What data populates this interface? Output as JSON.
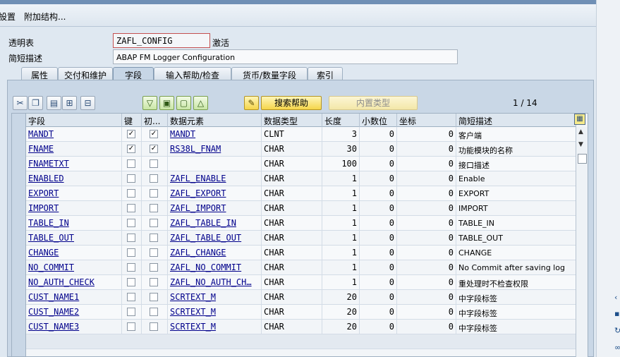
{
  "menu": {
    "item1": "設置",
    "item2": "附加结构..."
  },
  "header": {
    "table_label": "透明表",
    "table_name": "ZAFL_CONFIG",
    "status": "激活",
    "desc_label": "简短描述",
    "desc_value": "ABAP FM Logger Configuration"
  },
  "tabs": [
    "属性",
    "交付和维护",
    "字段",
    "输入帮助/检查",
    "货币/数量字段",
    "索引"
  ],
  "toolbar": {
    "search_help": "搜索帮助",
    "builtin_type": "内置类型",
    "pager": "1  /  14"
  },
  "columns": [
    "字段",
    "键",
    "初...",
    "数据元素",
    "数据类型",
    "长度",
    "小数位",
    "坐标",
    "简短描述"
  ],
  "rows": [
    {
      "field": "MANDT",
      "key": true,
      "init": true,
      "element": "MANDT",
      "type": "CLNT",
      "length": "3",
      "decimals": "0",
      "coord": "0",
      "desc": "客户端"
    },
    {
      "field": "FNAME",
      "key": true,
      "init": true,
      "element": "RS38L_FNAM",
      "type": "CHAR",
      "length": "30",
      "decimals": "0",
      "coord": "0",
      "desc": "功能模块的名称"
    },
    {
      "field": "FNAMETXT",
      "key": false,
      "init": false,
      "element": "",
      "type": "CHAR",
      "length": "100",
      "decimals": "0",
      "coord": "0",
      "desc": "接口描述"
    },
    {
      "field": "ENABLED",
      "key": false,
      "init": false,
      "element": "ZAFL_ENABLE",
      "type": "CHAR",
      "length": "1",
      "decimals": "0",
      "coord": "0",
      "desc": "Enable"
    },
    {
      "field": "EXPORT",
      "key": false,
      "init": false,
      "element": "ZAFL_EXPORT",
      "type": "CHAR",
      "length": "1",
      "decimals": "0",
      "coord": "0",
      "desc": "EXPORT"
    },
    {
      "field": "IMPORT",
      "key": false,
      "init": false,
      "element": "ZAFL_IMPORT",
      "type": "CHAR",
      "length": "1",
      "decimals": "0",
      "coord": "0",
      "desc": "IMPORT"
    },
    {
      "field": "TABLE_IN",
      "key": false,
      "init": false,
      "element": "ZAFL_TABLE_IN",
      "type": "CHAR",
      "length": "1",
      "decimals": "0",
      "coord": "0",
      "desc": "TABLE_IN"
    },
    {
      "field": "TABLE_OUT",
      "key": false,
      "init": false,
      "element": "ZAFL_TABLE_OUT",
      "type": "CHAR",
      "length": "1",
      "decimals": "0",
      "coord": "0",
      "desc": "TABLE_OUT"
    },
    {
      "field": "CHANGE",
      "key": false,
      "init": false,
      "element": "ZAFL_CHANGE",
      "type": "CHAR",
      "length": "1",
      "decimals": "0",
      "coord": "0",
      "desc": "CHANGE"
    },
    {
      "field": "NO_COMMIT",
      "key": false,
      "init": false,
      "element": "ZAFL_NO_COMMIT",
      "type": "CHAR",
      "length": "1",
      "decimals": "0",
      "coord": "0",
      "desc": "No Commit after saving log"
    },
    {
      "field": "NO_AUTH_CHECK",
      "key": false,
      "init": false,
      "element": "ZAFL_NO_AUTH_CH…",
      "type": "CHAR",
      "length": "1",
      "decimals": "0",
      "coord": "0",
      "desc": "重处理时不检查权限"
    },
    {
      "field": "CUST_NAME1",
      "key": false,
      "init": false,
      "element": "SCRTEXT_M",
      "type": "CHAR",
      "length": "20",
      "decimals": "0",
      "coord": "0",
      "desc": "中字段标签"
    },
    {
      "field": "CUST_NAME2",
      "key": false,
      "init": false,
      "element": "SCRTEXT_M",
      "type": "CHAR",
      "length": "20",
      "decimals": "0",
      "coord": "0",
      "desc": "中字段标签"
    },
    {
      "field": "CUST_NAME3",
      "key": false,
      "init": false,
      "element": "SCRTEXT_M",
      "type": "CHAR",
      "length": "20",
      "decimals": "0",
      "coord": "0",
      "desc": "中字段标签"
    }
  ],
  "colors": {
    "accent": "#c9d7e6",
    "link": "#00008b",
    "button_yellow": "#f5d54a"
  },
  "icons": [
    "cut-icon",
    "copy-icon",
    "paste-icon",
    "insert-row-icon",
    "delete-row-icon",
    "filter-icon",
    "select-all-icon",
    "deselect-all-icon",
    "up-icon",
    "pencil-icon",
    "grid-config-icon"
  ]
}
